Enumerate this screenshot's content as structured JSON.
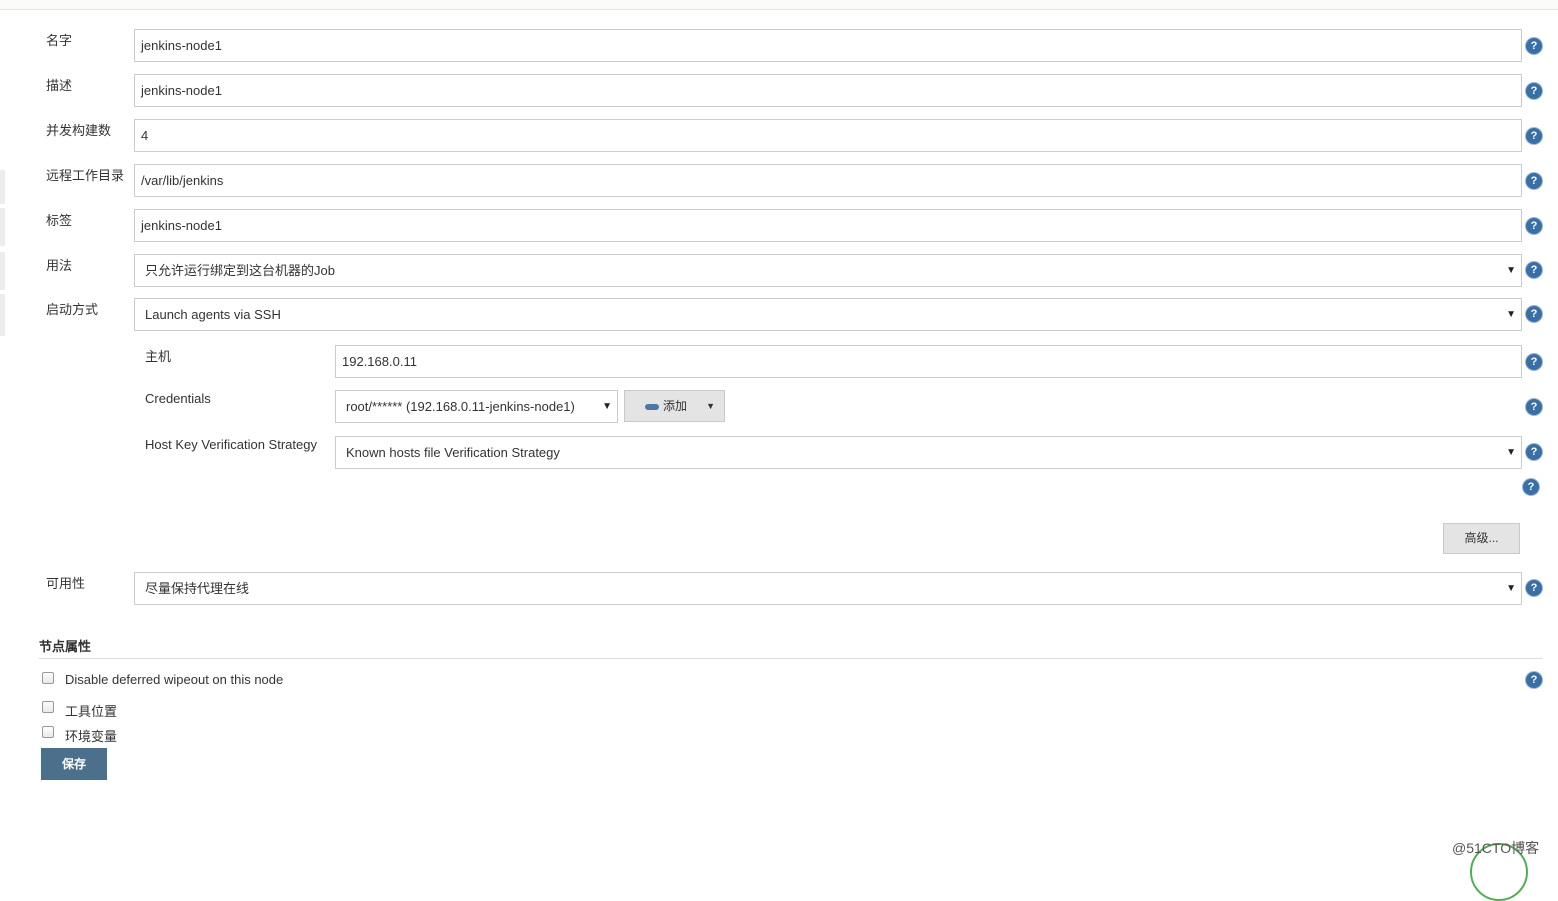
{
  "form": {
    "name": {
      "label": "名字",
      "value": "jenkins-node1"
    },
    "description": {
      "label": "描述",
      "value": "jenkins-node1"
    },
    "executors": {
      "label": "并发构建数",
      "value": "4"
    },
    "remote_dir": {
      "label": "远程工作目录",
      "value": "/var/lib/jenkins"
    },
    "labels": {
      "label": "标签",
      "value": "jenkins-node1"
    },
    "usage": {
      "label": "用法",
      "value": "只允许运行绑定到这台机器的Job"
    },
    "launch": {
      "label": "启动方式",
      "value": "Launch agents via SSH"
    },
    "host": {
      "label": "主机",
      "value": "192.168.0.11"
    },
    "credentials": {
      "label": "Credentials",
      "value": "root/****** (192.168.0.11-jenkins-node1)",
      "add_label": "添加"
    },
    "host_key": {
      "label": "Host Key Verification Strategy",
      "value": "Known hosts file Verification Strategy"
    },
    "advanced_label": "高级...",
    "availability": {
      "label": "可用性",
      "value": "尽量保持代理在线"
    }
  },
  "node_properties": {
    "title": "节点属性",
    "items": [
      {
        "label": "Disable deferred wipeout on this node",
        "checked": false
      },
      {
        "label": "工具位置",
        "checked": false
      },
      {
        "label": "环境变量",
        "checked": false
      }
    ]
  },
  "save_label": "保存",
  "help_glyph": "?",
  "select_arrow": "▼",
  "watermark": "@51CTO博客"
}
